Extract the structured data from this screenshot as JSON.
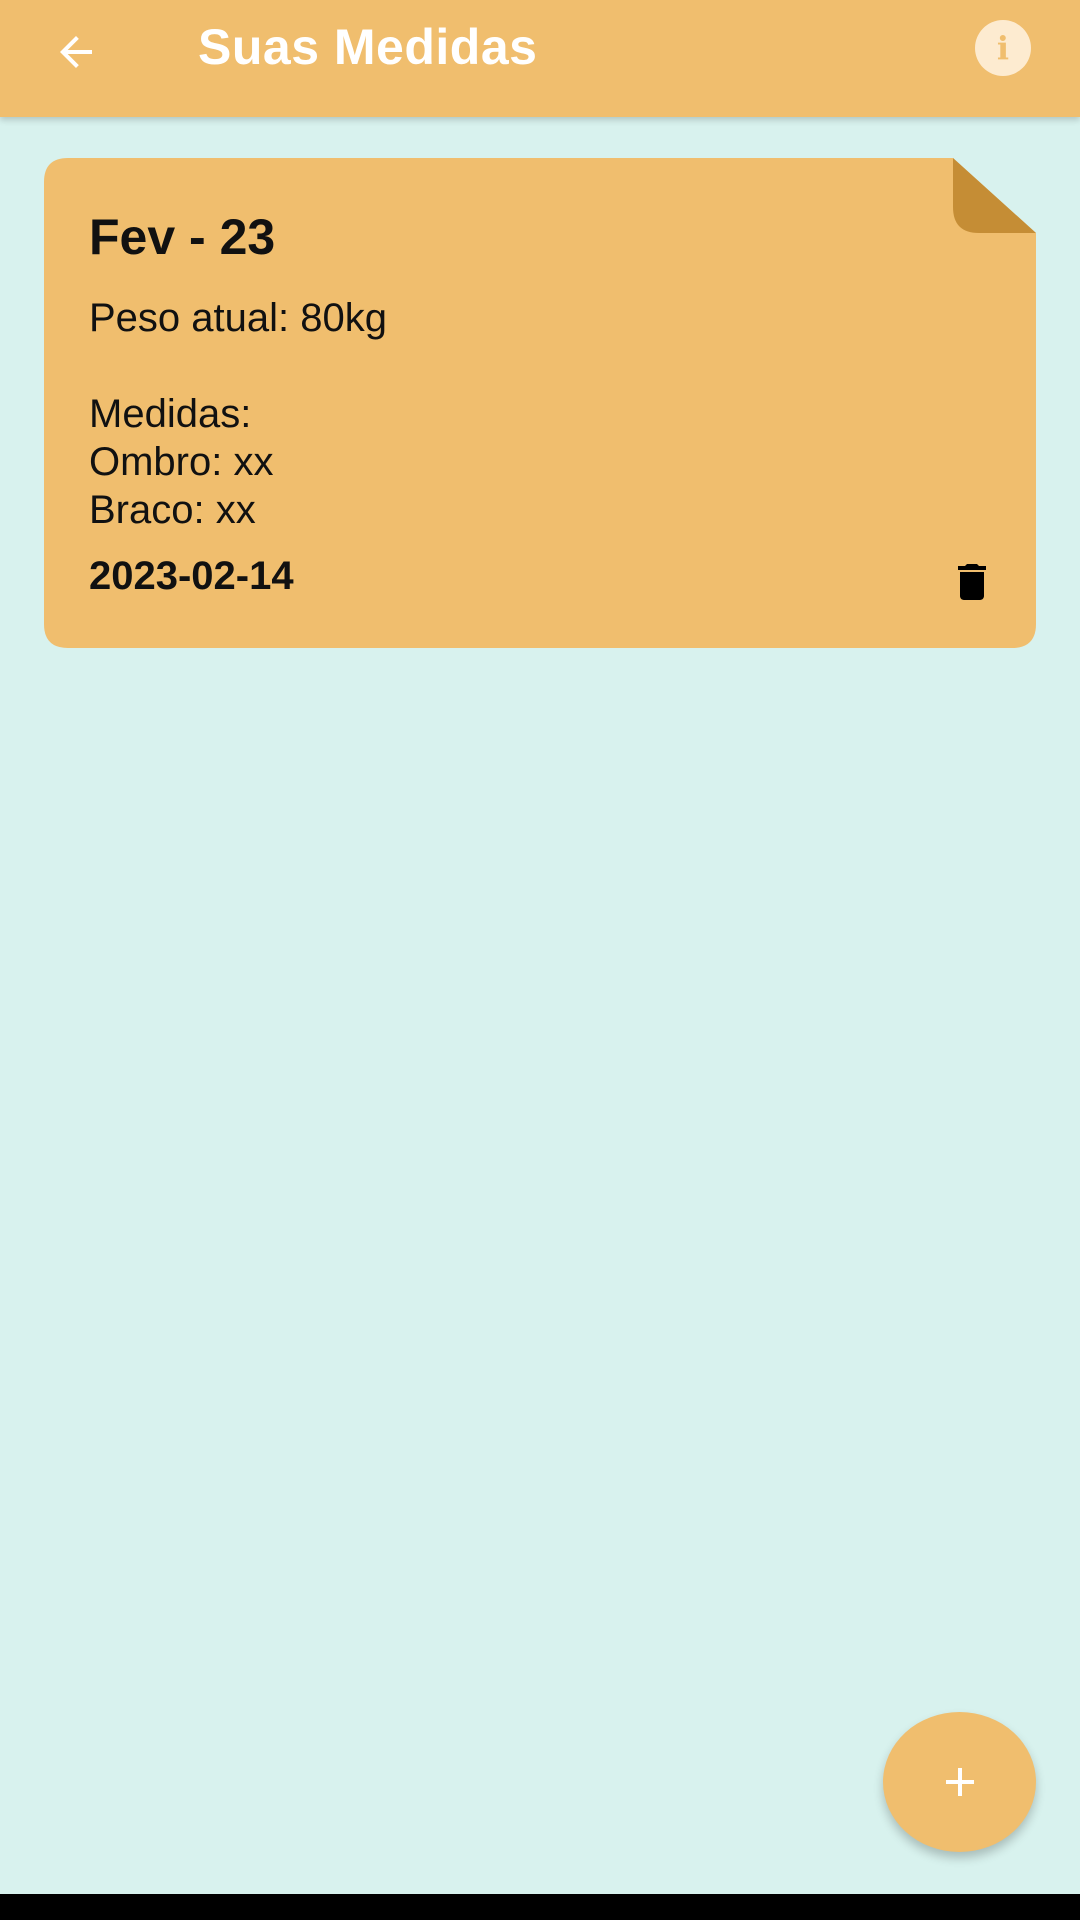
{
  "app_bar": {
    "title": "Suas Medidas",
    "back_icon": "arrow-back-icon",
    "info_icon": "info-icon",
    "info_glyph": "i",
    "color": "#f0be6e"
  },
  "notes": [
    {
      "title": "Fev - 23",
      "lines": [
        "Peso atual: 80kg",
        "",
        "Medidas:",
        "Ombro: xx",
        "Braco: xx"
      ],
      "date": "2023-02-14",
      "delete_icon": "trash-icon",
      "card_color": "#f0be6e",
      "fold_color": "#c58d35"
    }
  ],
  "fab": {
    "icon": "plus-icon",
    "color": "#f0be6e"
  },
  "background_color": "#d8f2ee"
}
